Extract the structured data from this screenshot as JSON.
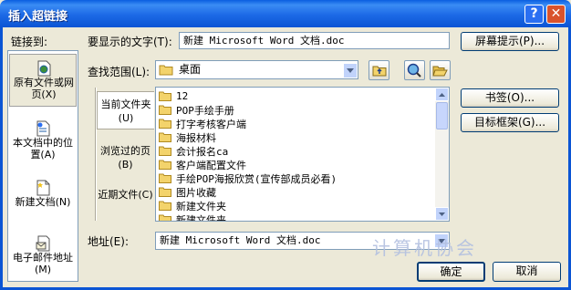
{
  "window": {
    "title": "插入超链接",
    "help_glyph": "?",
    "close_glyph": "✕"
  },
  "labels": {
    "link_to": "链接到:",
    "display_text": "要显示的文字(T):",
    "look_in": "查找范围(L):",
    "address": "地址(E):"
  },
  "linkbar": {
    "items": [
      {
        "label": "原有文件或网页(X)",
        "icon": "web-page-icon",
        "selected": true
      },
      {
        "label": "本文档中的位置(A)",
        "icon": "document-place-icon",
        "selected": false
      },
      {
        "label": "新建文档(N)",
        "icon": "new-document-icon",
        "selected": false
      },
      {
        "label": "电子邮件地址(M)",
        "icon": "email-icon",
        "selected": false
      }
    ]
  },
  "display_text_value": "新建 Microsoft Word 文档.doc",
  "look_in_value": "桌面",
  "subtabs": [
    "当前文件夹(U)",
    "浏览过的页(B)",
    "近期文件(C)"
  ],
  "files": [
    "12",
    "POP手绘手册",
    "打字考核客户端",
    "海报材料",
    "会计报名ca",
    "客户端配置文件",
    "手绘POP海报欣赏(宣传部成员必看)",
    "图片收藏",
    "新建文件夹",
    "新建文件夹"
  ],
  "address_value": "新建 Microsoft Word 文档.doc",
  "buttons": {
    "screen_tip": "屏幕提示(P)...",
    "bookmark": "书签(O)...",
    "target_frame": "目标框架(G)...",
    "ok": "确定",
    "cancel": "取消"
  },
  "watermark": "计算机协会",
  "colors": {
    "title_bar": "#0b55d4",
    "dialog_bg": "#ece9d8",
    "field_border": "#7f9db9",
    "close_button": "#d9532c",
    "folder": "#f3d36b"
  }
}
